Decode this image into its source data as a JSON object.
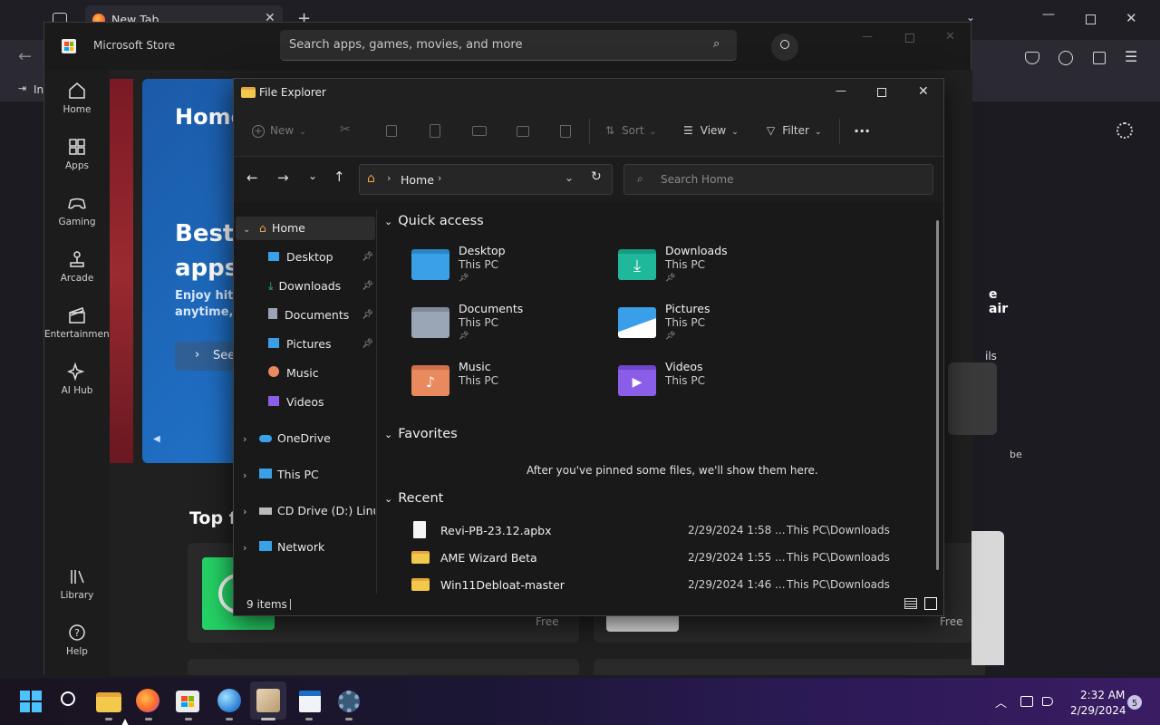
{
  "browser": {
    "tab_title": "New Tab",
    "bookmark_partial": "In"
  },
  "store": {
    "title": "Microsoft Store",
    "search_placeholder": "Search apps, games, movies, and more",
    "nav": [
      {
        "label": "Home",
        "icon": "home-icon"
      },
      {
        "label": "Apps",
        "icon": "apps-icon"
      },
      {
        "label": "Gaming",
        "icon": "gamepad-icon"
      },
      {
        "label": "Arcade",
        "icon": "joystick-icon"
      },
      {
        "label": "Entertainment",
        "icon": "clapper-icon"
      },
      {
        "label": "AI Hub",
        "icon": "sparkle-icon"
      },
      {
        "label": "Library",
        "icon": "library-icon"
      },
      {
        "label": "Help",
        "icon": "help-icon"
      }
    ],
    "hero": {
      "heading": "Home",
      "headline_line1": "Best",
      "headline_line2": "apps",
      "sub_line1": "Enjoy hit m",
      "sub_line2": "anytime, a",
      "cta": "See"
    },
    "section_title": "Top free ap",
    "right_peek": {
      "air": "e air",
      "ils": "ils",
      "be": "be"
    },
    "free_labels": [
      "Free",
      "Free"
    ]
  },
  "explorer": {
    "title": "File Explorer",
    "toolbar": {
      "new": "New",
      "sort": "Sort",
      "view": "View",
      "filter": "Filter",
      "more": "..."
    },
    "address": {
      "crumb": "Home"
    },
    "search_placeholder": "Search Home",
    "tree": [
      {
        "label": "Home",
        "icon": "home-icon"
      },
      {
        "label": "Desktop",
        "icon": "desktop-icon"
      },
      {
        "label": "Downloads",
        "icon": "download-icon"
      },
      {
        "label": "Documents",
        "icon": "document-icon"
      },
      {
        "label": "Pictures",
        "icon": "picture-icon"
      },
      {
        "label": "Music",
        "icon": "music-icon"
      },
      {
        "label": "Videos",
        "icon": "video-icon"
      },
      {
        "label": "OneDrive",
        "icon": "cloud-icon"
      },
      {
        "label": "This PC",
        "icon": "pc-icon"
      },
      {
        "label": "CD Drive (D:) Linux I",
        "icon": "cd-drive-icon"
      },
      {
        "label": "Network",
        "icon": "network-icon"
      }
    ],
    "quick_access": {
      "heading": "Quick access",
      "items": [
        {
          "name": "Desktop",
          "location": "This PC",
          "color": "#3aa0e8"
        },
        {
          "name": "Downloads",
          "location": "This PC",
          "color": "#1fb89a"
        },
        {
          "name": "Documents",
          "location": "This PC",
          "color": "#9aa5b5"
        },
        {
          "name": "Pictures",
          "location": "This PC",
          "color": "#3a9ee8"
        },
        {
          "name": "Music",
          "location": "This PC",
          "color": "#e88a5e"
        },
        {
          "name": "Videos",
          "location": "This PC",
          "color": "#8a5ee8"
        }
      ]
    },
    "favorites": {
      "heading": "Favorites",
      "empty_message": "After you've pinned some files, we'll show them here."
    },
    "recent": {
      "heading": "Recent",
      "rows": [
        {
          "name": "Revi-PB-23.12.apbx",
          "date": "2/29/2024 1:58 ...",
          "location": "This PC\\Downloads",
          "kind": "file"
        },
        {
          "name": "AME Wizard Beta",
          "date": "2/29/2024 1:55 ...",
          "location": "This PC\\Downloads",
          "kind": "folder"
        },
        {
          "name": "Win11Debloat-master",
          "date": "2/29/2024 1:46 ...",
          "location": "This PC\\Downloads",
          "kind": "folder"
        }
      ]
    },
    "status": {
      "count": "9 items"
    }
  },
  "taskbar": {
    "time": "2:32 AM",
    "date": "2/29/2024",
    "notification_count": "5"
  }
}
